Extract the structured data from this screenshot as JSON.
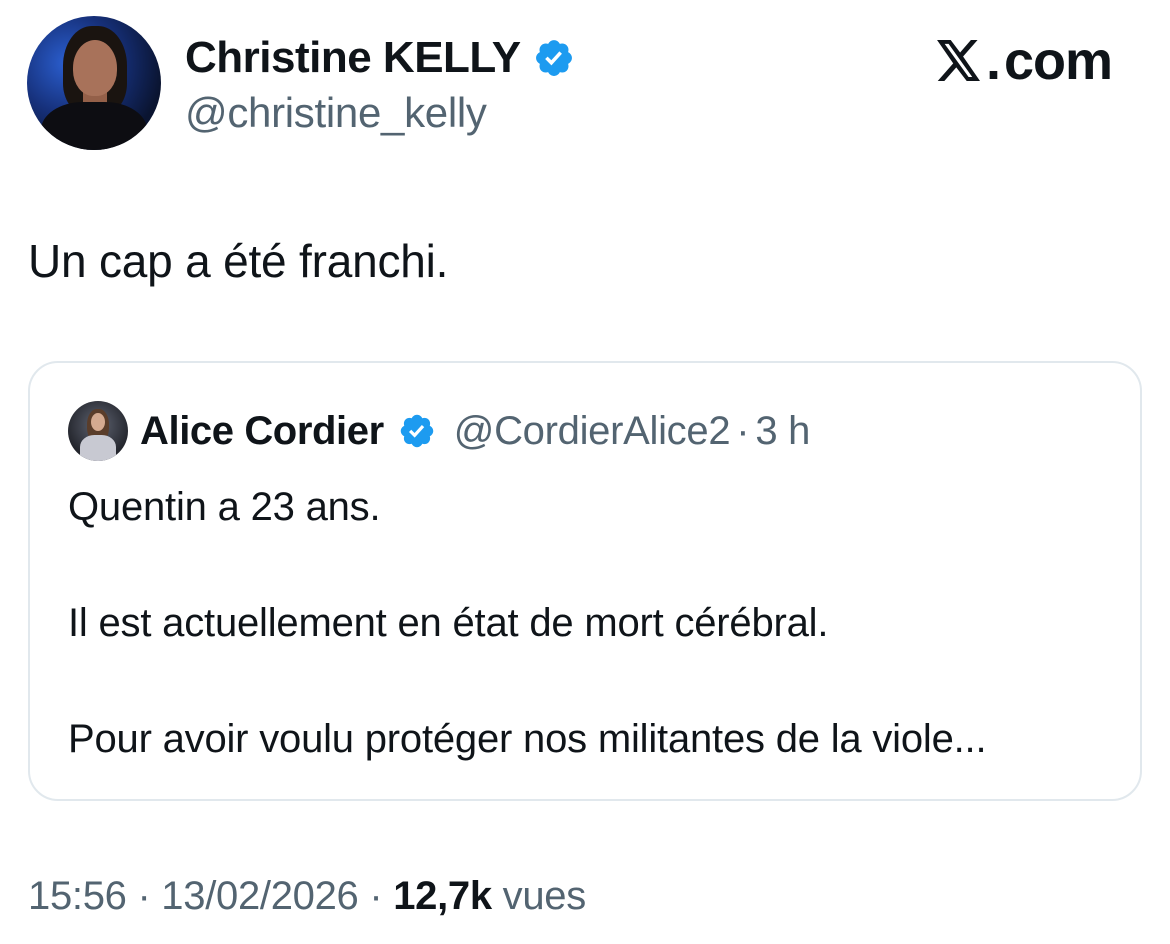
{
  "author": {
    "name": "Christine KELLY",
    "handle": "@christine_kelly",
    "verified": true
  },
  "site": {
    "label": "com",
    "logo_icon": "x-logo-icon"
  },
  "tweet": {
    "text": "Un cap a été franchi."
  },
  "quoted_tweet": {
    "name": "Alice Cordier",
    "handle": "@CordierAlice2",
    "separator": "·",
    "time": "3 h",
    "verified": true,
    "lines": [
      "Quentin a 23 ans.",
      "Il est actuellement en état de mort cérébral.",
      "Pour avoir voulu protéger nos militantes de la viole..."
    ]
  },
  "meta": {
    "time": "15:56",
    "separator": "·",
    "date": "13/02/2026",
    "views_count": "12,7k",
    "views_label": "vues"
  },
  "colors": {
    "verified_badge": "#1d9bf0",
    "secondary_text": "#536471",
    "primary_text": "#0f1419",
    "card_border": "#e1e8ed"
  }
}
